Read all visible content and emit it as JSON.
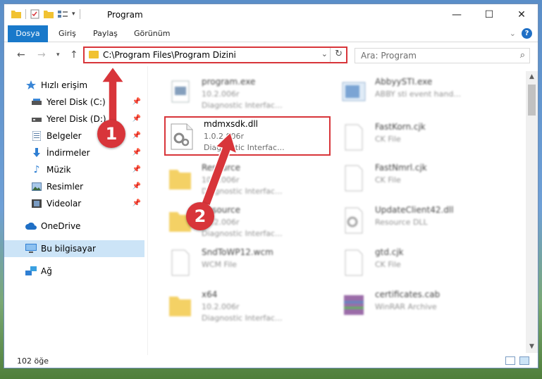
{
  "window": {
    "title": "Program"
  },
  "ribbon": {
    "tabs": [
      "Dosya",
      "Giriş",
      "Paylaş",
      "Görünüm"
    ]
  },
  "address": {
    "path": "C:\\Program Files\\Program Dizini"
  },
  "search": {
    "placeholder": "Ara: Program"
  },
  "sidebar": {
    "items": [
      {
        "label": "Hızlı erişim",
        "icon": "star-icon"
      },
      {
        "label": "Yerel Disk (C:)",
        "icon": "disk-icon",
        "pinned": true
      },
      {
        "label": "Yerel Disk (D:)",
        "icon": "disk-icon",
        "pinned": true
      },
      {
        "label": "Belgeler",
        "icon": "documents-icon",
        "pinned": true
      },
      {
        "label": "İndirmeler",
        "icon": "download-icon",
        "pinned": true
      },
      {
        "label": "Müzik",
        "icon": "music-icon",
        "pinned": true
      },
      {
        "label": "Resimler",
        "icon": "pictures-icon",
        "pinned": true
      },
      {
        "label": "Videolar",
        "icon": "videos-icon",
        "pinned": true
      },
      {
        "label": "OneDrive",
        "icon": "cloud-icon"
      },
      {
        "label": "Bu bilgisayar",
        "icon": "computer-icon",
        "selected": true
      },
      {
        "label": "Ağ",
        "icon": "network-icon"
      }
    ]
  },
  "files": [
    {
      "name": "program.exe",
      "version": "10.2.006r",
      "desc": "Diagnostic Interfac...",
      "blurred": true
    },
    {
      "name": "AbbyySTI.exe",
      "version": "ABBY sti event hand...",
      "desc": "",
      "blurred": true
    },
    {
      "name": "mdmxsdk.dll",
      "version": "1.0.2.006r",
      "desc": "Diagnostic Interfac...",
      "blurred": false
    },
    {
      "name": "FastKorn.cjk",
      "version": "CK File",
      "desc": "",
      "blurred": true
    },
    {
      "name": "Resource",
      "version": "10.2.006r",
      "desc": "Diagnostic Interfac...",
      "blurred": true
    },
    {
      "name": "FastNmrl.cjk",
      "version": "CK File",
      "desc": "",
      "blurred": true
    },
    {
      "name": "Resource",
      "version": "10.2.006r",
      "desc": "Diagnostic Interfac...",
      "blurred": true
    },
    {
      "name": "UpdateClient42.dll",
      "version": "Resource DLL",
      "desc": "",
      "blurred": true
    },
    {
      "name": "SndToWP12.wcm",
      "version": "WCM File",
      "desc": "",
      "blurred": true
    },
    {
      "name": "gtd.cjk",
      "version": "CK File",
      "desc": "",
      "blurred": true
    },
    {
      "name": "x64",
      "version": "10.2.006r",
      "desc": "Diagnostic Interfac...",
      "blurred": true
    },
    {
      "name": "certificates.cab",
      "version": "WinRAR Archive",
      "desc": "",
      "blurred": true
    }
  ],
  "status": {
    "count": "102 öğe"
  },
  "annotations": {
    "step1": "1",
    "step2": "2"
  },
  "colors": {
    "accent": "#1979ca",
    "highlight": "#d8353a",
    "selected": "#cce4f7"
  }
}
